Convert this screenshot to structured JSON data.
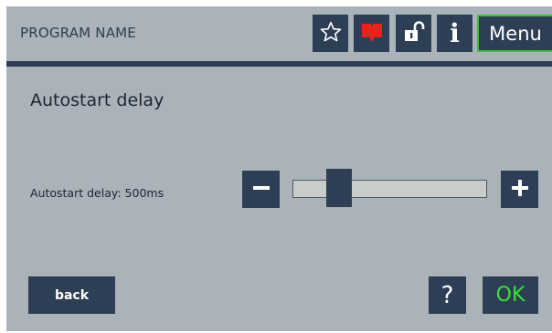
{
  "header": {
    "program_name": "PROGRAM NAME",
    "menu_label": "Menu",
    "info_label": "i",
    "icons": {
      "favorite": "star-icon",
      "bookmark": "bookmark-icon",
      "lock": "unlock-icon",
      "info": "info-icon"
    }
  },
  "page": {
    "title": "Autostart delay"
  },
  "setting": {
    "label": "Autostart delay: 500ms",
    "value_ms": 500,
    "slider_level": 0.2
  },
  "footer": {
    "back_label": "back",
    "help_label": "?",
    "ok_label": "OK"
  },
  "colors": {
    "background": "#aab2ba",
    "button": "#2e3f55",
    "accent_green": "#3fbf3f",
    "bookmark_red": "#e8231c"
  }
}
